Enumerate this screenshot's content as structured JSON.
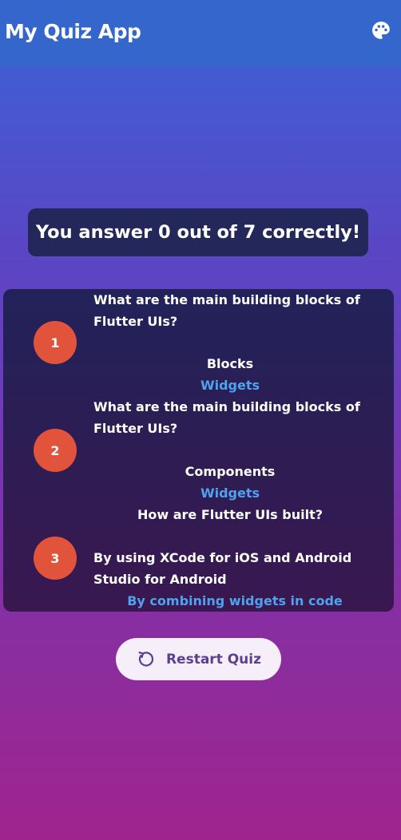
{
  "appbar": {
    "title": "My Quiz App",
    "action_icon": "palette-icon"
  },
  "result": {
    "score_text": "You answer 0 out of 7 correctly!"
  },
  "summary": [
    {
      "number": "1",
      "question": "What are the main building blocks of Flutter UIs?",
      "user_answer": "Blocks",
      "correct_answer": "Widgets"
    },
    {
      "number": "2",
      "question": "What are the main building blocks of Flutter UIs?",
      "user_answer": "Components",
      "correct_answer": "Widgets"
    },
    {
      "number": "3",
      "question": "How are Flutter UIs built?",
      "user_answer": "By using XCode for iOS and Android Studio for Android",
      "correct_answer": "By combining widgets in code"
    }
  ],
  "restart": {
    "label": "Restart Quiz",
    "icon": "restart-icon"
  },
  "colors": {
    "appbar": "#3566cc",
    "badge": "#e2533b",
    "correct_answer": "#4ea2ee",
    "button_text": "#5b3f93"
  }
}
